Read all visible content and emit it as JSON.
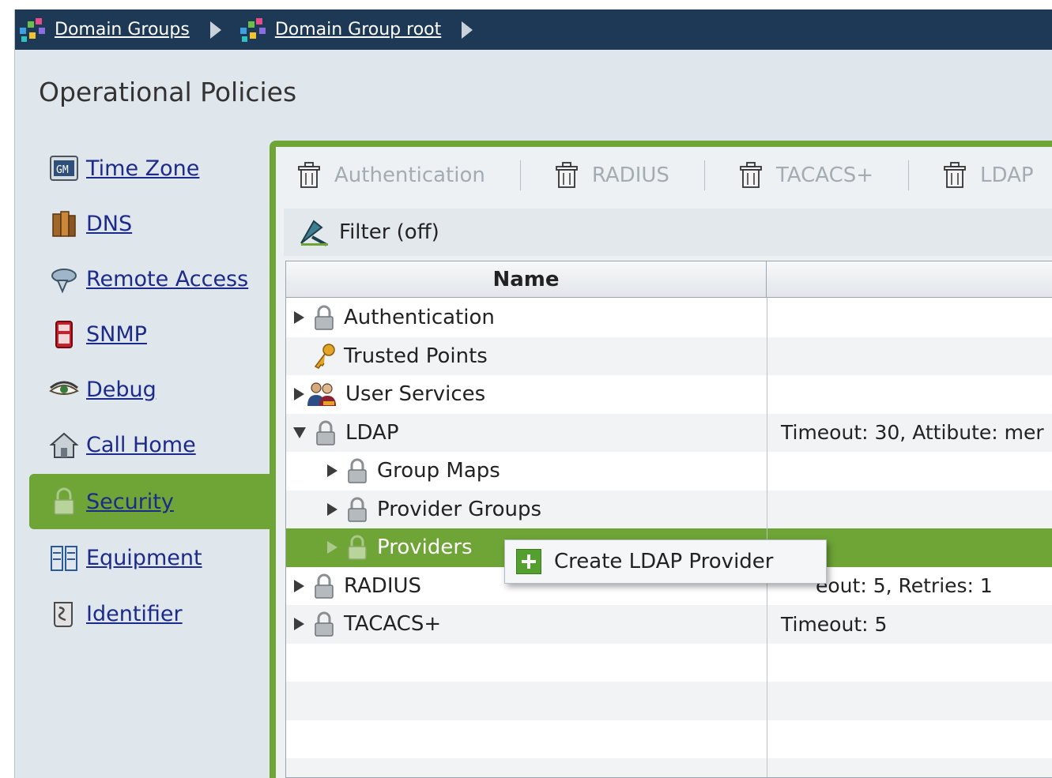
{
  "breadcrumb": {
    "items": [
      {
        "label": "Domain Groups"
      },
      {
        "label": "Domain Group root"
      }
    ]
  },
  "header": {
    "title": "Operational Policies"
  },
  "leftnav": {
    "items": [
      {
        "label": "Time Zone",
        "icon": "clock-icon"
      },
      {
        "label": "DNS",
        "icon": "books-icon"
      },
      {
        "label": "Remote Access",
        "icon": "remote-access-icon"
      },
      {
        "label": "SNMP",
        "icon": "phone-icon"
      },
      {
        "label": "Debug",
        "icon": "eye-icon"
      },
      {
        "label": "Call Home",
        "icon": "house-icon"
      },
      {
        "label": "Security",
        "icon": "lock-icon",
        "active": true
      },
      {
        "label": "Equipment",
        "icon": "equipment-icon"
      },
      {
        "label": "Identifier",
        "icon": "scroll-icon"
      }
    ]
  },
  "toolbar": {
    "buttons": [
      {
        "label": "Authentication"
      },
      {
        "label": "RADIUS"
      },
      {
        "label": "TACACS+"
      },
      {
        "label": "LDAP"
      }
    ]
  },
  "filter": {
    "label": "Filter (off)"
  },
  "grid": {
    "columns": [
      "Name",
      ""
    ],
    "rows": [
      {
        "name": "Authentication",
        "desc": "",
        "expander": "collapsed",
        "indent": 0,
        "icon": "lock-icon"
      },
      {
        "name": "Trusted Points",
        "desc": "",
        "expander": "none",
        "indent": 0,
        "icon": "key-icon"
      },
      {
        "name": "User Services",
        "desc": "",
        "expander": "collapsed",
        "indent": 0,
        "icon": "users-icon"
      },
      {
        "name": "LDAP",
        "desc": "Timeout: 30, Attibute: mer",
        "expander": "expanded",
        "indent": 0,
        "icon": "lock-icon"
      },
      {
        "name": "Group Maps",
        "desc": "",
        "expander": "collapsed",
        "indent": 1,
        "icon": "lock-icon"
      },
      {
        "name": "Provider Groups",
        "desc": "",
        "expander": "collapsed",
        "indent": 1,
        "icon": "lock-icon"
      },
      {
        "name": "Providers",
        "desc": "",
        "expander": "collapsed",
        "indent": 1,
        "icon": "lock-icon",
        "selected": true
      },
      {
        "name": "RADIUS",
        "desc": "eout: 5, Retries: 1",
        "expander": "collapsed",
        "indent": 0,
        "icon": "lock-icon"
      },
      {
        "name": "TACACS+",
        "desc": "Timeout: 5",
        "expander": "collapsed",
        "indent": 0,
        "icon": "lock-icon"
      }
    ]
  },
  "context_menu": {
    "items": [
      {
        "label": "Create LDAP Provider",
        "icon": "plus-icon"
      }
    ]
  },
  "colors": {
    "nav_dark": "#1d3956",
    "accent_green": "#6ea536",
    "panel_bg": "#dfe6ec",
    "link": "#1c2a8a"
  }
}
